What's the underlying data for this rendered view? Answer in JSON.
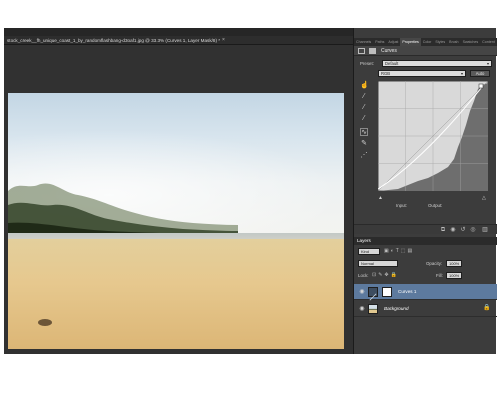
{
  "document": {
    "tab_title": "stock_creek__fh_unique_coast_1_by_randomflashbang-d3oaf1.jpg @ 33.3% (Curves 1, Layer Mask/8) *",
    "close_glyph": "×"
  },
  "panel": {
    "tabs": [
      "Channels",
      "Paths",
      "Adjust",
      "Properties",
      "Color",
      "Styles",
      "Brush",
      "Swatches",
      "Content"
    ],
    "active_tab": "Properties"
  },
  "properties": {
    "title": "Curves",
    "preset_label": "Preset:",
    "preset_value": "Default",
    "channel_value": "RGB",
    "auto_label": "Auto",
    "input_label": "Input:",
    "output_label": "Output:"
  },
  "layers": {
    "title": "Layers",
    "kind_label": "Kind",
    "blend_mode": "Normal",
    "opacity_label": "Opacity:",
    "opacity_value": "100%",
    "lock_label": "Lock:",
    "fill_label": "Fill:",
    "fill_value": "100%",
    "items": [
      {
        "name": "Curves 1"
      },
      {
        "name": "Background"
      }
    ]
  },
  "colors": {
    "selected_layer": "#5d7a9e",
    "panel_bg": "#3c3c3c",
    "workspace_bg": "#262626"
  },
  "icons": {
    "visibility": "eye-icon",
    "lock": "lock-icon",
    "curve_tools": [
      "pointer-hand-icon",
      "black-point-eyedropper-icon",
      "gray-point-eyedropper-icon",
      "white-point-eyedropper-icon",
      "curve-point-icon",
      "pencil-icon",
      "smooth-icon"
    ]
  }
}
